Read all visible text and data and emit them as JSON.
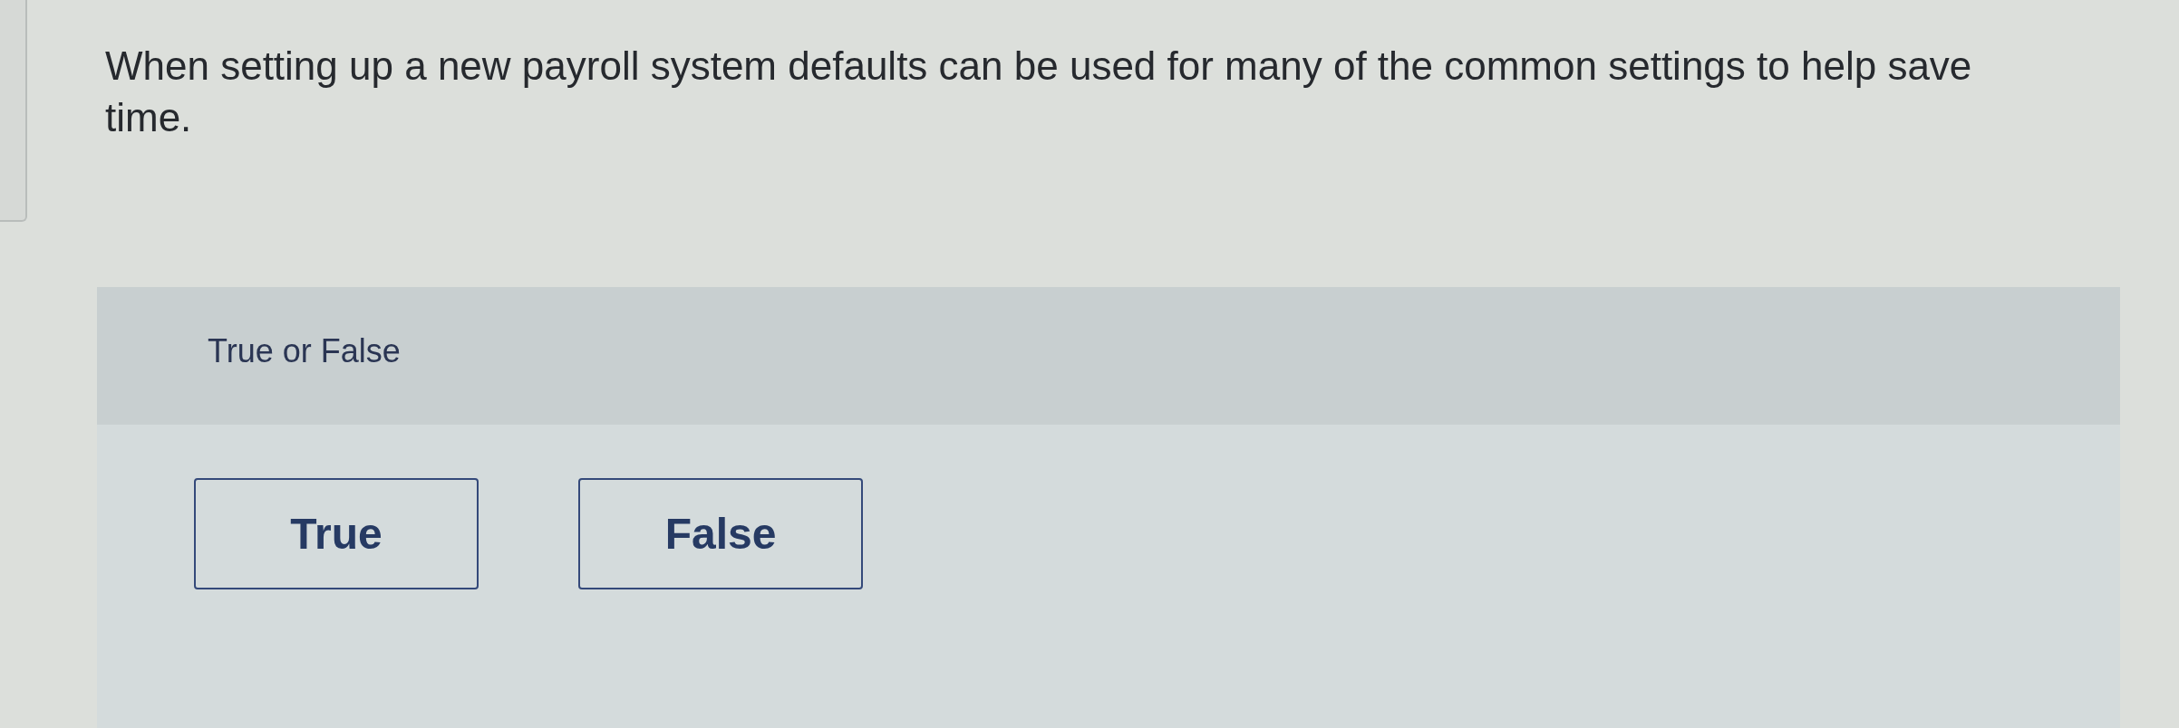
{
  "question": {
    "text": "When setting up a new payroll system defaults can be used for many of the common settings to help save time."
  },
  "answer_panel": {
    "prompt": "True or False",
    "options": [
      {
        "label": "True",
        "selected": false
      },
      {
        "label": "False",
        "selected": false
      }
    ]
  }
}
